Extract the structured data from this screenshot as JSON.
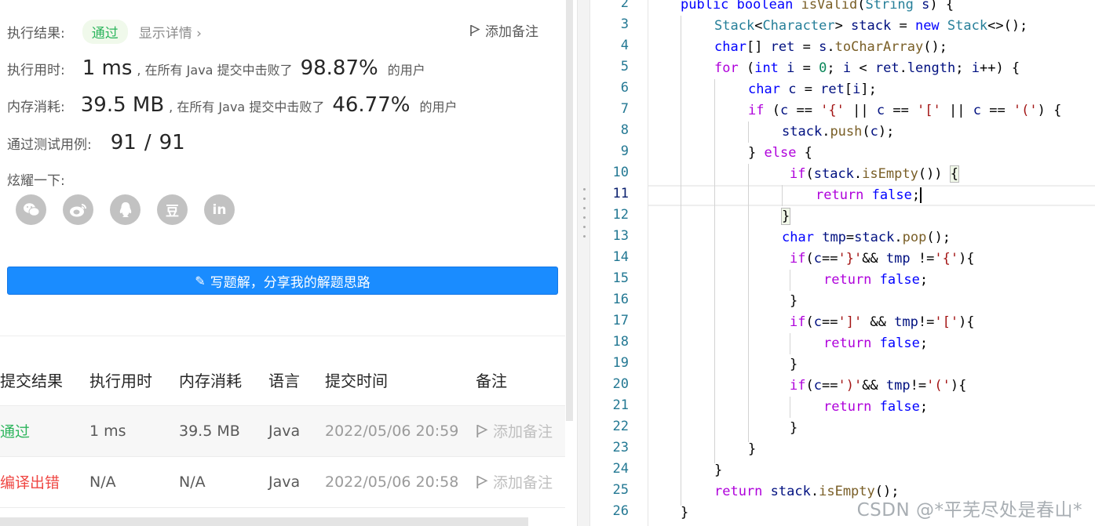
{
  "result": {
    "label": "执行结果:",
    "status": "通过",
    "details_link": "显示详情 ›",
    "add_note": "添加备注"
  },
  "runtime": {
    "label": "执行用时:",
    "value": "1 ms",
    "mid_text": ", 在所有 Java 提交中击败了",
    "percent": "98.87%",
    "suffix": "的用户"
  },
  "memory": {
    "label": "内存消耗:",
    "value": "39.5 MB",
    "mid_text": ", 在所有 Java 提交中击败了",
    "percent": "46.77%",
    "suffix": "的用户"
  },
  "tests": {
    "label": "通过测试用例:",
    "passed": "91",
    "sep": "/",
    "total": "91"
  },
  "share": {
    "label": "炫耀一下:",
    "icons": [
      "wechat-icon",
      "weibo-icon",
      "qq-icon",
      "douban-icon",
      "linkedin-icon"
    ],
    "douban_glyph": "豆",
    "linkedin_glyph": "in"
  },
  "write_button": {
    "label": "写题解，分享我的解题思路"
  },
  "submissions": {
    "headers": [
      "提交结果",
      "执行用时",
      "内存消耗",
      "语言",
      "提交时间",
      "备注"
    ],
    "rows": [
      {
        "result": "通过",
        "time": "1 ms",
        "memory": "39.5 MB",
        "lang": "Java",
        "submitted": "2022/05/06 20:59",
        "note": "添加备注"
      },
      {
        "result": "编译出错",
        "time": "N/A",
        "memory": "N/A",
        "lang": "Java",
        "submitted": "2022/05/06 20:58",
        "note": "添加备注"
      }
    ]
  },
  "editor": {
    "line_numbers": [
      "2",
      "3",
      "4",
      "5",
      "6",
      "7",
      "8",
      "9",
      "10",
      "11",
      "12",
      "13",
      "14",
      "15",
      "16",
      "17",
      "18",
      "19",
      "20",
      "21",
      "22",
      "23",
      "24",
      "25",
      "26"
    ],
    "active_line": "11"
  },
  "watermark": "CSDN @*平芜尽处是春山*",
  "colors": {
    "accent_blue": "#1a8cff",
    "pass_green": "#2db55d",
    "error_red": "#ef4743",
    "line_number": "#237893"
  }
}
